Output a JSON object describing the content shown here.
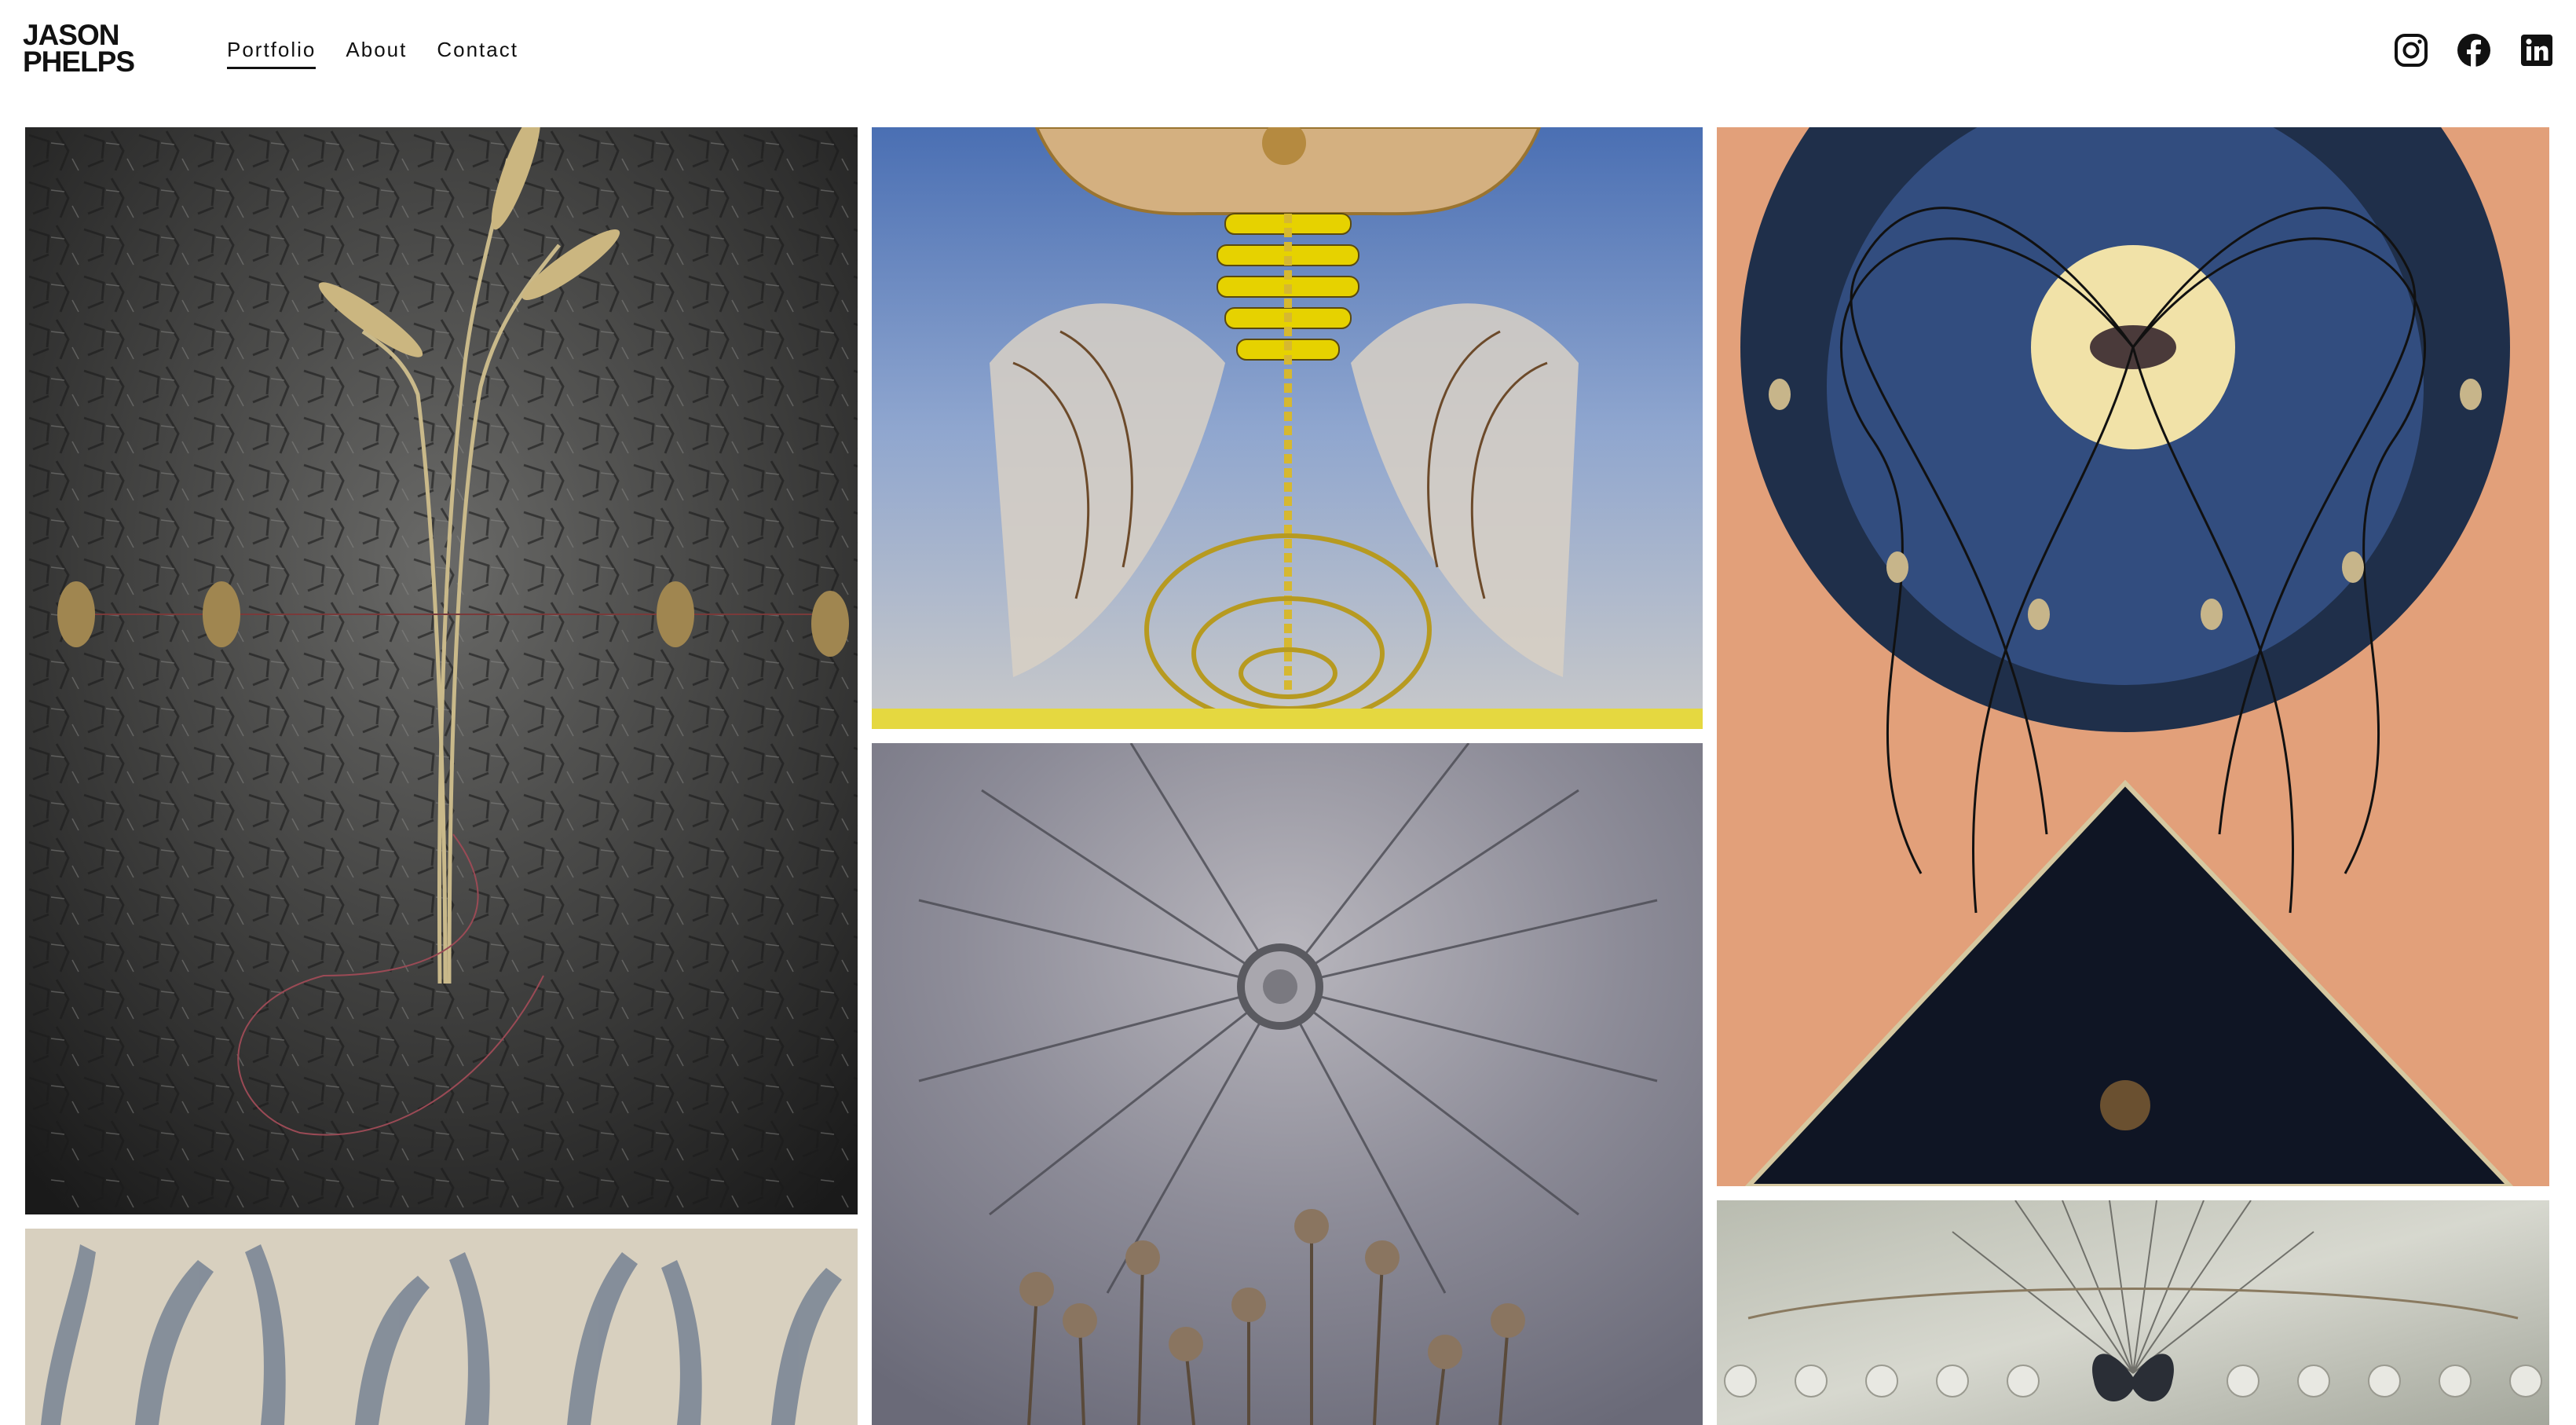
{
  "brand": {
    "line1": "JASON",
    "line2": "PHELPS"
  },
  "nav": [
    {
      "label": "Portfolio",
      "active": true
    },
    {
      "label": "About",
      "active": false
    },
    {
      "label": "Contact",
      "active": false
    }
  ],
  "social": [
    "instagram-icon",
    "facebook-icon",
    "linkedin-icon"
  ],
  "gallery": [
    {
      "name": "artwork-wheat-cracked-black"
    },
    {
      "name": "artwork-ribcage-flames"
    },
    {
      "name": "artwork-blue-moon-pyramid"
    },
    {
      "name": "artwork-radiating-dried-flowers"
    },
    {
      "name": "artwork-grey-wheat-texture"
    },
    {
      "name": "artwork-silver-butterfly"
    }
  ]
}
